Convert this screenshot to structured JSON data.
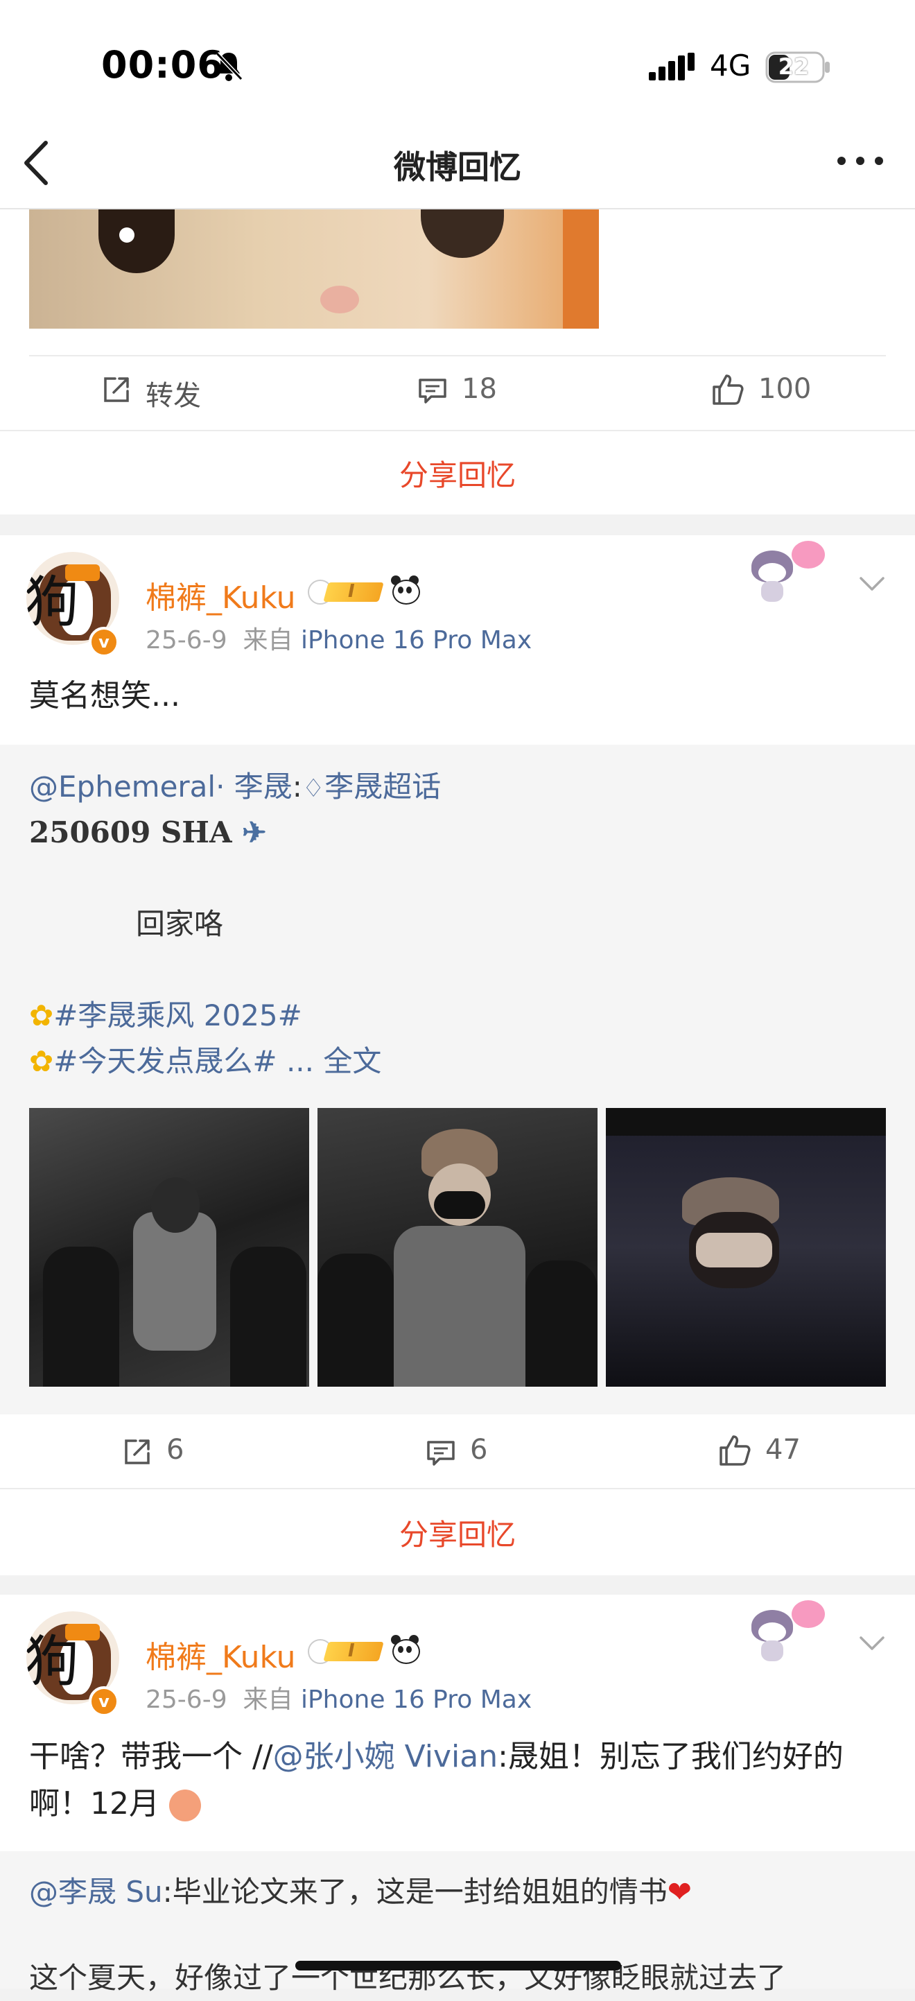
{
  "status_bar": {
    "time": "00:06",
    "network": "4G",
    "battery": "22"
  },
  "nav": {
    "title": "微博回忆"
  },
  "post0": {
    "actions": {
      "repost": "转发",
      "comments": "18",
      "likes": "100"
    },
    "share": "分享回忆"
  },
  "post1": {
    "username": "棉裤_Kuku",
    "level": "I",
    "date": "25-6-9",
    "from": "来自",
    "device": "iPhone 16 Pro Max",
    "avatar_char": "狗",
    "text": "莫名想笑...",
    "quote": {
      "mention": "@Ephemeral· 李晟",
      "colon": ":",
      "topic": "李晟超话",
      "line1": "250609 SHA",
      "line2": "回家咯",
      "tag1": "#李晟乘风 2025#",
      "tag2": "#今天发点晟么#",
      "ellipsis": " ... ",
      "fulltext": "全文"
    },
    "actions": {
      "reposts": "6",
      "comments": "6",
      "likes": "47"
    },
    "share": "分享回忆"
  },
  "post2": {
    "username": "棉裤_Kuku",
    "level": "I",
    "date": "25-6-9",
    "from": "来自",
    "device": "iPhone 16 Pro Max",
    "avatar_char": "狗",
    "text_a": "干啥？带我一个 //",
    "mention": "@张小婉 Vivian",
    "text_b": ":晟姐！别忘了我们约好的",
    "text_c": "啊！12月",
    "quote": {
      "mention": "@李晟 Su",
      "text": ":毕业论文来了，这是一封给姐姐的情书",
      "line2": "这个夏天，好像过了一个世纪那么长，又好像眨眼就过去了"
    }
  },
  "colors": {
    "accent": "#e8482a",
    "username": "#f07a1a",
    "link": "#4c6a9a"
  }
}
